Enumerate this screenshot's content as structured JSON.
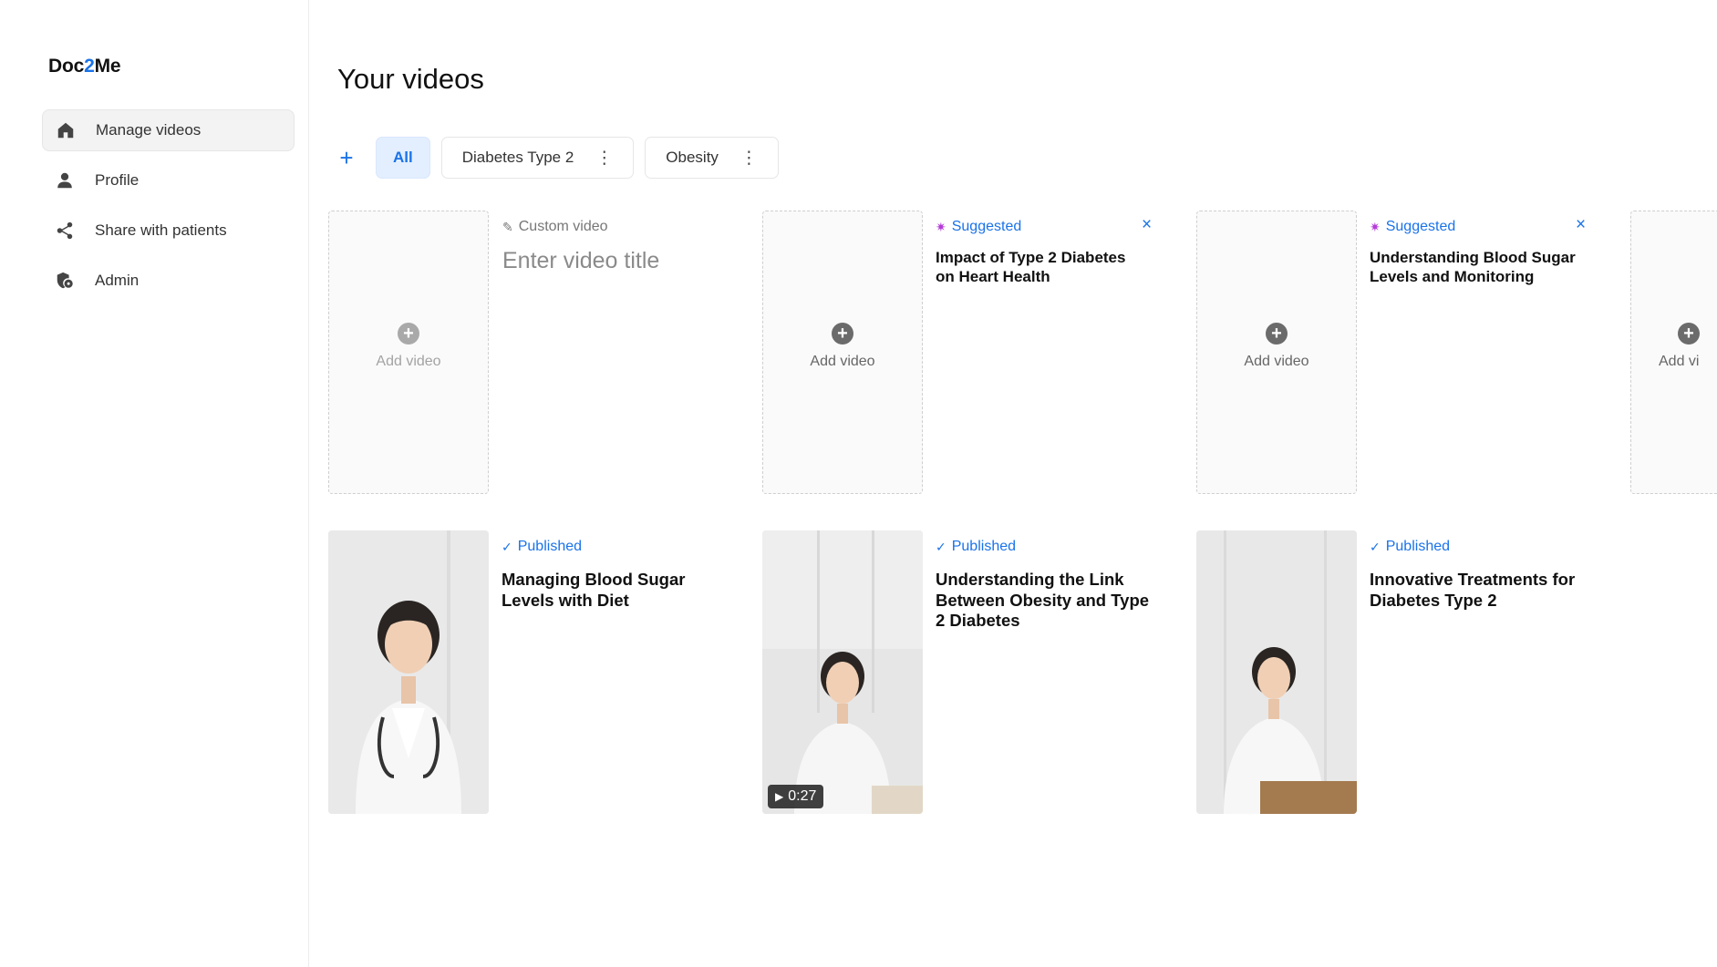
{
  "app": {
    "logo_prefix": "Doc",
    "logo_accent": "2",
    "logo_suffix": "Me"
  },
  "sidebar": {
    "items": [
      {
        "label": "Manage videos",
        "icon": "home-icon",
        "active": true
      },
      {
        "label": "Profile",
        "icon": "person-icon",
        "active": false
      },
      {
        "label": "Share with patients",
        "icon": "share-icon",
        "active": false
      },
      {
        "label": "Admin",
        "icon": "admin-shield-icon",
        "active": false
      }
    ]
  },
  "main": {
    "title": "Your videos",
    "tabs": [
      {
        "label": "All",
        "active": true
      },
      {
        "label": "Diabetes Type 2",
        "active": false
      },
      {
        "label": "Obesity",
        "active": false
      }
    ],
    "add_tab_symbol": "+",
    "slot_label": "Add video",
    "slot_label_partial": "Add vi",
    "row1": [
      {
        "tag": "Custom video",
        "tag_icon": "pencil-icon",
        "placeholder": "Enter video title"
      },
      {
        "tag": "Suggested",
        "tag_icon": "sparkle-icon",
        "title": "Impact of Type 2 Diabetes on Heart Health",
        "close": "×"
      },
      {
        "tag": "Suggested",
        "tag_icon": "sparkle-icon",
        "title": "Understanding Blood Sugar Levels and Monitoring",
        "close": "×"
      }
    ],
    "row2": [
      {
        "tag": "Published",
        "tag_icon": "check-icon",
        "title": "Managing Blood Sugar Levels with Diet"
      },
      {
        "tag": "Published",
        "tag_icon": "check-icon",
        "title": "Understanding the Link Between Obesity and Type 2 Diabetes",
        "duration": "0:27"
      },
      {
        "tag": "Published",
        "tag_icon": "check-icon",
        "title": "Innovative Treatments for Diabetes Type 2"
      }
    ]
  },
  "colors": {
    "accent": "#1a73e8",
    "suggested_icon": "#b43cd8"
  }
}
